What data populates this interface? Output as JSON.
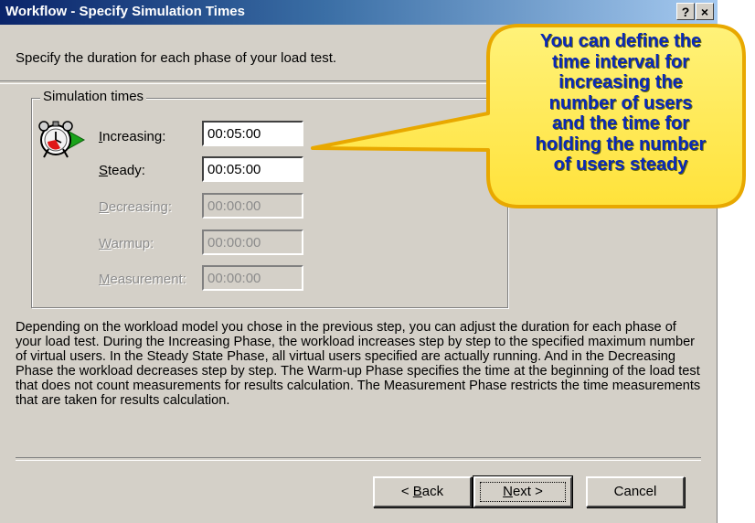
{
  "window": {
    "title": "Workflow - Specify Simulation Times",
    "help_button": "?",
    "close_button": "×"
  },
  "subtitle": "Specify the duration for each phase of your load test.",
  "simulation_times": {
    "group_label": "Simulation times",
    "icon": "stopwatch-icon",
    "fields": [
      {
        "key": "I",
        "rest": "ncreasing:",
        "value": "00:05:00",
        "enabled": true
      },
      {
        "key": "S",
        "rest": "teady:",
        "value": "00:05:00",
        "enabled": true
      },
      {
        "key": "D",
        "rest": "ecreasing:",
        "value": "00:00:00",
        "enabled": false
      },
      {
        "key": "W",
        "rest": "armup:",
        "value": "00:00:00",
        "enabled": false
      },
      {
        "key": "M",
        "rest": "easurement:",
        "value": "00:00:00",
        "enabled": false
      }
    ]
  },
  "description": "Depending on the workload model you chose in the previous step, you can adjust the duration for each phase of your load test. During the Increasing Phase, the workload increases step by step to the specified maximum number of virtual users. In the Steady State Phase, all virtual users specified are actually running. And in the Decreasing Phase the workload decreases step by step. The Warm-up Phase specifies the time at the beginning of the load test that does not count measurements for results calculation.  The Measurement Phase restricts the time measurements that are taken for results calculation.",
  "buttons": {
    "back_prefix": "< ",
    "back_key": "B",
    "back_rest": "ack",
    "next_key": "N",
    "next_rest": "ext >",
    "cancel": "Cancel"
  },
  "callout": {
    "lines": [
      "You can define the",
      "time interval for",
      "increasing the",
      "number of users",
      "and the time for",
      "holding the number",
      "of users steady"
    ]
  },
  "colors": {
    "title_bar": "#0a246a",
    "dialog_face": "#d4d0c8",
    "callout_fill": "#ffee55",
    "callout_border": "#e8a800",
    "callout_text": "#0a28b8"
  }
}
